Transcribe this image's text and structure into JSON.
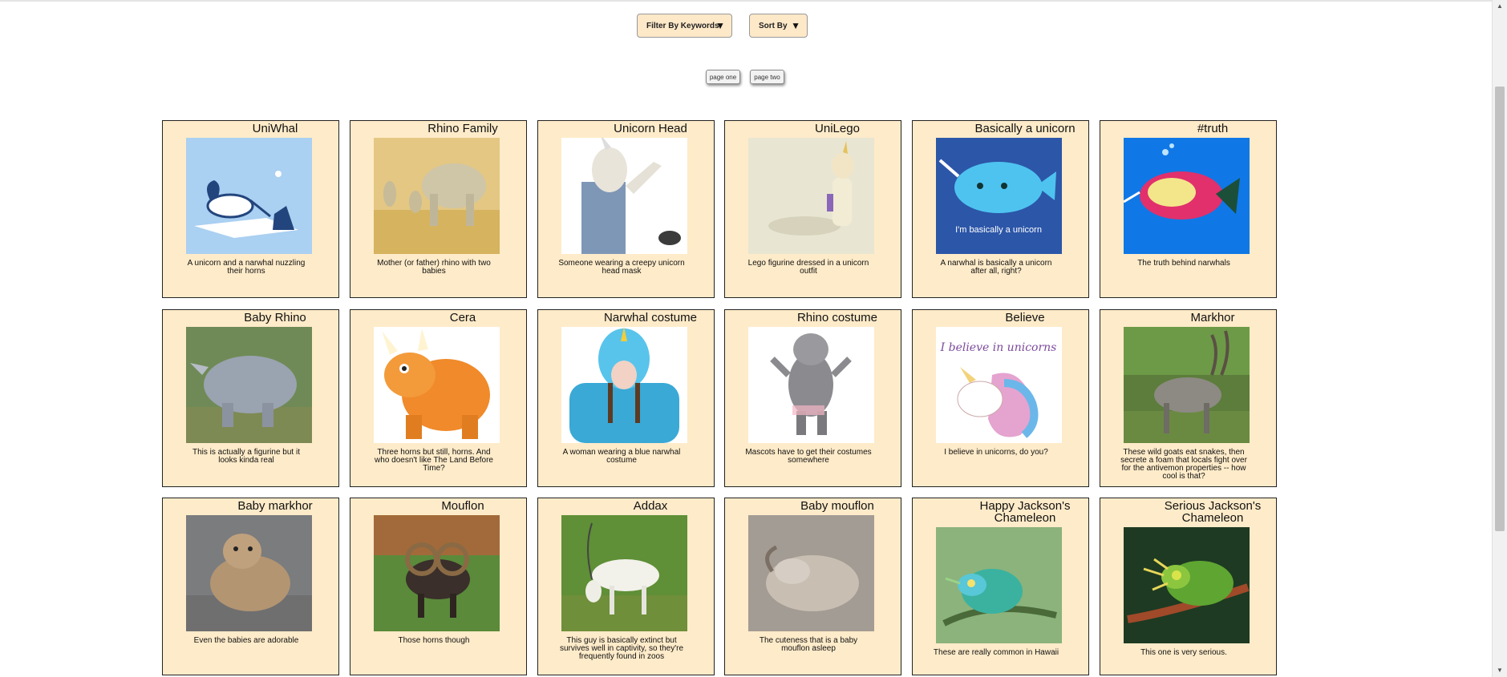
{
  "controls": {
    "filter_label": "Filter By Keywords",
    "sort_label": "Sort By",
    "arrow_glyph": "▼"
  },
  "pager": {
    "page_one": "page one",
    "page_two": "page two"
  },
  "scrollbar": {
    "up_glyph": "▲",
    "down_glyph": "▼"
  },
  "cards": [
    {
      "title": "UniWhal",
      "desc": "A unicorn and a narwhal nuzzling their horns",
      "icon": "unicorn-narwhal-image",
      "bg": "#aad0f2"
    },
    {
      "title": "Rhino Family",
      "desc": "Mother (or father) rhino with two babies",
      "icon": "rhino-family-image",
      "bg": "#e3c783"
    },
    {
      "title": "Unicorn Head",
      "desc": "Someone wearing a creepy unicorn head mask",
      "icon": "unicorn-mask-image",
      "bg": "#ffffff"
    },
    {
      "title": "UniLego",
      "desc": "Lego figurine dressed in a unicorn outfit",
      "icon": "lego-unicorn-image",
      "bg": "#e8e6d2"
    },
    {
      "title": "Basically a unicorn",
      "desc": "A narwhal is basically a unicorn after all, right?",
      "icon": "narwhal-cartoon-image",
      "bg": "#2c56a8",
      "caption": "I'm basically a unicorn"
    },
    {
      "title": "#truth",
      "desc": "The truth behind narwhals",
      "icon": "truth-narwhal-image",
      "bg": "#0f78e6"
    },
    {
      "title": "Baby Rhino",
      "desc": "This is actually a figurine but it looks kinda real",
      "icon": "baby-rhino-image",
      "bg": "#6f8a56"
    },
    {
      "title": "Cera",
      "desc": "Three horns but still, horns. And who doesn't like The Land Before Time?",
      "icon": "triceratops-image",
      "bg": "#ffffff"
    },
    {
      "title": "Narwhal costume",
      "desc": "A woman wearing a blue narwhal costume",
      "icon": "narwhal-costume-image",
      "bg": "#ffffff"
    },
    {
      "title": "Rhino costume",
      "desc": "Mascots have to get their costumes somewhere",
      "icon": "rhino-mascot-image",
      "bg": "#ffffff"
    },
    {
      "title": "Believe",
      "desc": "I believe in unicorns, do you?",
      "icon": "believe-unicorn-image",
      "bg": "#ffffff",
      "caption": "I believe in unicorns"
    },
    {
      "title": "Markhor",
      "desc": "These wild goats eat snakes, then secrete a foam that locals fight over for the antivemon properties -- how cool is that?",
      "icon": "markhor-image",
      "bg": "#5c7d3b"
    },
    {
      "title": "Baby markhor",
      "desc": "Even the babies are adorable",
      "icon": "baby-markhor-image",
      "bg": "#7a7c7e"
    },
    {
      "title": "Mouflon",
      "desc": "Those horns though",
      "icon": "mouflon-image",
      "bg": "#5a8a3a"
    },
    {
      "title": "Addax",
      "desc": "This guy is basically extinct but survives well in captivity, so they're frequently found in zoos",
      "icon": "addax-image",
      "bg": "#5f8f36"
    },
    {
      "title": "Baby mouflon",
      "desc": "The cuteness that is a baby mouflon asleep",
      "icon": "baby-mouflon-image",
      "bg": "#a39c94"
    },
    {
      "title": "Happy Jackson's Chameleon",
      "desc": "These are really common in Hawaii",
      "icon": "happy-chameleon-image",
      "bg": "#7ea86a"
    },
    {
      "title": "Serious Jackson's Chameleon",
      "desc": "This one is very serious.",
      "icon": "serious-chameleon-image",
      "bg": "#1e3a22"
    }
  ]
}
